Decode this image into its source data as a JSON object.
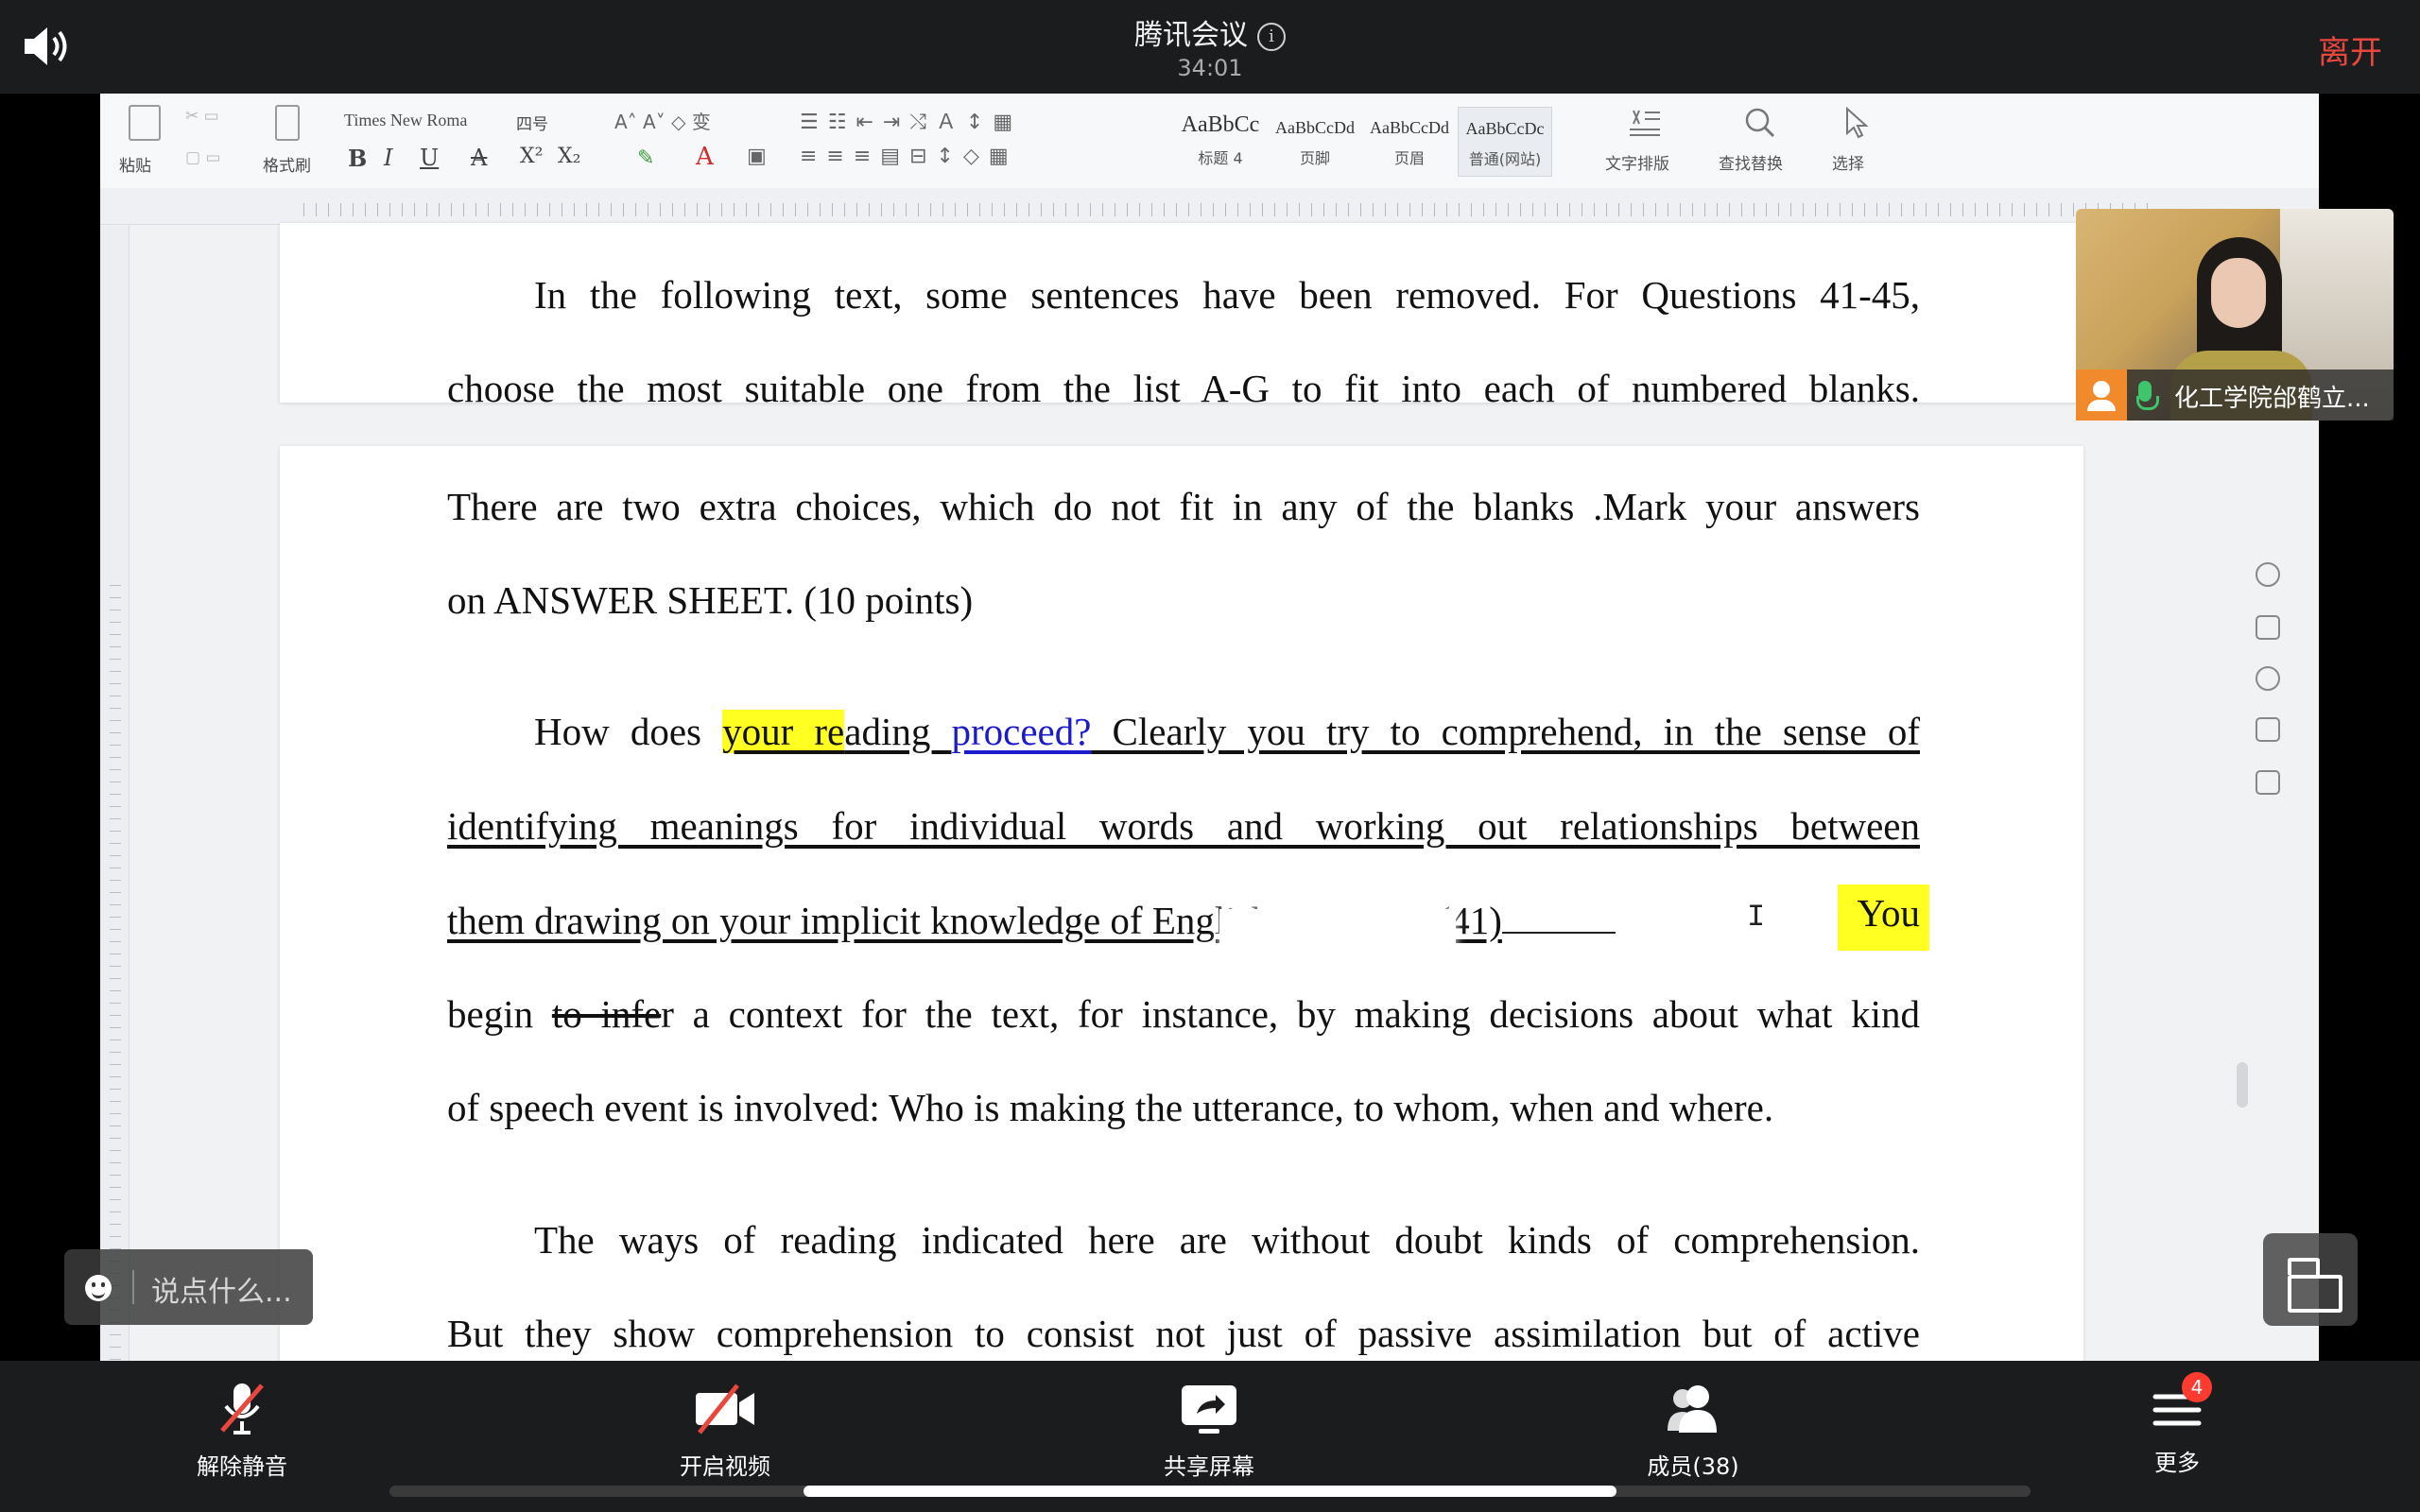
{
  "meeting": {
    "title": "腾讯会议",
    "timer": "34:01",
    "leave_label": "离开"
  },
  "wps_ribbon": {
    "paste_label": "粘贴",
    "format_painter_label": "格式刷",
    "font_name": "Times New Roma",
    "font_size": "四号",
    "format_buttons": [
      "B",
      "I",
      "U",
      "A",
      "X²",
      "X₂"
    ],
    "styles": [
      {
        "sample": "AaBbCc",
        "name": "标题 4"
      },
      {
        "sample": "AaBbCcDd",
        "name": "页脚"
      },
      {
        "sample": "AaBbCcDd",
        "name": "页眉"
      },
      {
        "sample": "AaBbCcDc",
        "name": "普通(网站)"
      }
    ],
    "text_layout_label": "文字排版",
    "find_replace_label": "查找替换",
    "select_label": "选择"
  },
  "document": {
    "page1_lines": [
      "In the following text, some sentences have been removed. For Questions 41-45,",
      "choose the most suitable one from the list A-G to fit into each of numbered blanks."
    ],
    "para1_lines": [
      "There are two extra choices, which do not fit in any of the blanks .Mark your answers",
      "on ANSWER SHEET. (10 points)"
    ],
    "para2": {
      "l1_a": "How does ",
      "l1_hl": "your re",
      "l1_b": "ading ",
      "l1_blue": "proceed?",
      "l1_c": " Clearly you try to comprehend, in the sense of",
      "l2": "identifying meanings for individual words and working out relationships between",
      "l3_a": "them drawing on your implicit knowledge of English grammar. (41)",
      "l3_hl": "You",
      "l4_a": "begin ",
      "l4_strike": "to infe",
      "l4_b": "r a context for the text, for instance, by making decisions about what kind",
      "l5": "of speech event is involved: Who is making the utterance, to whom, when and where."
    },
    "para3_lines": [
      "The ways of reading indicated here are without doubt kinds of comprehension.",
      "But they show comprehension to consist not just of passive assimilation but of active"
    ]
  },
  "participant": {
    "name": "化工学院邰鹤立..."
  },
  "chat": {
    "placeholder": "说点什么..."
  },
  "bottom_bar": {
    "mute_label": "解除静音",
    "video_label": "开启视频",
    "share_label": "共享屏幕",
    "members_label": "成员(38)",
    "more_label": "更多",
    "more_badge": "4"
  },
  "colors": {
    "leave": "#e8473e",
    "highlight": "#ffff22",
    "link_blue": "#1b1bcc",
    "mic_active": "#3ec46d",
    "badge": "#ff3b30"
  }
}
